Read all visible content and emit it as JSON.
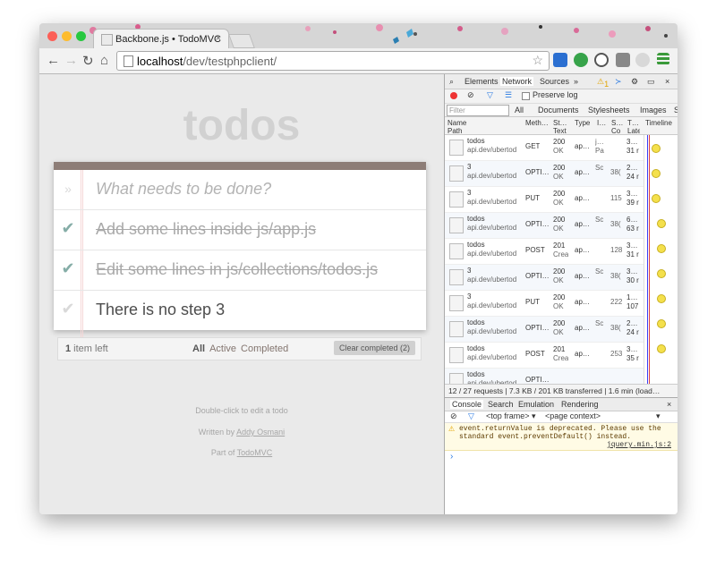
{
  "browser": {
    "tab_title": "Backbone.js • TodoMVC",
    "tab_close": "×",
    "url_host": "localhost",
    "url_path": "/dev/testphpclient/"
  },
  "todo": {
    "title": "todos",
    "new_placeholder": "What needs to be done?",
    "items": [
      {
        "text": "Add some lines inside js/app.js",
        "done": true
      },
      {
        "text": "Edit some lines in js/collections/todos.js",
        "done": true
      },
      {
        "text": "There is no step 3",
        "done": false
      }
    ],
    "count_num": "1",
    "count_label": " item left",
    "filters": [
      "All",
      "Active",
      "Completed"
    ],
    "clear_label": "Clear completed (2)",
    "info": {
      "line1": "Double-click to edit a todo",
      "written_by": "Written by ",
      "author": "Addy Osmani",
      "part_of": "Part of ",
      "part_link": "TodoMVC"
    }
  },
  "devtools": {
    "tabs": [
      "Elements",
      "Network",
      "Sources",
      "»"
    ],
    "warn_count": "1",
    "preserve_log": "Preserve log",
    "filter_placeholder": "Filter",
    "types": [
      "All",
      "Documents",
      "Stylesheets",
      "Images",
      "S"
    ],
    "columns": [
      "Name\nPath",
      "Meth…",
      "St…\nText",
      "Type",
      "I…",
      "S…\nCo",
      "T…\nLate",
      "Timeline"
    ],
    "rows": [
      {
        "name": "todos",
        "path": "api.dev/ubertod",
        "method": "GET",
        "status": "200",
        "text": "OK",
        "type": "ap…",
        "init": "j…\nPa",
        "size": "",
        "time": "3…\n31 r"
      },
      {
        "name": "3",
        "path": "api.dev/ubertod",
        "method": "OPTI…",
        "status": "200",
        "text": "OK",
        "type": "ap…",
        "init": "Sc",
        "size": "38(",
        "time": "2…\n24 r"
      },
      {
        "name": "3",
        "path": "api.dev/ubertod",
        "method": "PUT",
        "status": "200",
        "text": "OK",
        "type": "ap…",
        "init": "",
        "size": "115",
        "time": "3…\n39 r"
      },
      {
        "name": "todos",
        "path": "api.dev/ubertod",
        "method": "OPTI…",
        "status": "200",
        "text": "OK",
        "type": "ap…",
        "init": "Sc",
        "size": "38(",
        "time": "6…\n63 r"
      },
      {
        "name": "todos",
        "path": "api.dev/ubertod",
        "method": "POST",
        "status": "201",
        "text": "Crea",
        "type": "ap…",
        "init": "",
        "size": "128",
        "time": "3…\n31 r"
      },
      {
        "name": "3",
        "path": "api.dev/ubertod",
        "method": "OPTI…",
        "status": "200",
        "text": "OK",
        "type": "ap…",
        "init": "Sc",
        "size": "38(",
        "time": "3…\n30 r"
      },
      {
        "name": "3",
        "path": "api.dev/ubertod",
        "method": "PUT",
        "status": "200",
        "text": "OK",
        "type": "ap…",
        "init": "",
        "size": "222",
        "time": "1…\n107"
      },
      {
        "name": "todos",
        "path": "api.dev/ubertod",
        "method": "OPTI…",
        "status": "200",
        "text": "OK",
        "type": "ap…",
        "init": "Sc",
        "size": "38(",
        "time": "2…\n24 r"
      },
      {
        "name": "todos",
        "path": "api.dev/ubertod",
        "method": "POST",
        "status": "201",
        "text": "Crea",
        "type": "ap…",
        "init": "",
        "size": "253",
        "time": "3…\n35 r"
      },
      {
        "name": "todos",
        "path": "api.dev/ubertod",
        "method": "OPTI…",
        "status": "",
        "text": "",
        "type": "",
        "init": "",
        "size": "",
        "time": ""
      }
    ],
    "status_bar": "12 / 27 requests | 7.3 KB / 201 KB transferred | 1.6 min (load…",
    "console_tabs": [
      "Console",
      "Search",
      "Emulation",
      "Rendering"
    ],
    "frame_label": "<top frame>",
    "context_label": "<page context>",
    "warning_text": "event.returnValue is deprecated. Please use the standard event.preventDefault() instead.",
    "warning_source": "jquery.min.js:2",
    "prompt": "›"
  }
}
